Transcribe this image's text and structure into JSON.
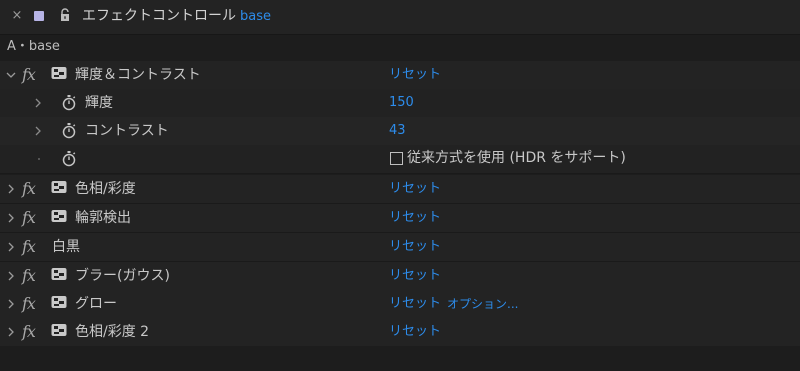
{
  "header": {
    "close_glyph": "×",
    "title": "エフェクトコントロール",
    "layer_name": "base",
    "swatch_color": "#b7b4e6"
  },
  "comp_path": "A・base",
  "accent_color": "#2d8ceb",
  "rows": [
    {
      "kind": "effect",
      "twirl": "expanded",
      "fx_label": "fx",
      "name": "輝度＆コントラスト",
      "reset": "リセット"
    },
    {
      "kind": "param",
      "name": "輝度",
      "value": "150"
    },
    {
      "kind": "param",
      "name": "コントラスト",
      "value": "43"
    },
    {
      "kind": "checkbox",
      "label": "従来方式を使用 (HDR をサポート)",
      "checked": false
    },
    {
      "kind": "effect",
      "twirl": "collapsed",
      "fx_label": "fx",
      "name": "色相/彩度",
      "reset": "リセット"
    },
    {
      "kind": "effect",
      "twirl": "collapsed",
      "fx_label": "fx",
      "name": "輪郭検出",
      "reset": "リセット"
    },
    {
      "kind": "effect",
      "twirl": "collapsed",
      "fx_label": "fx",
      "name": "白黒",
      "reset": "リセット"
    },
    {
      "kind": "effect",
      "twirl": "collapsed",
      "fx_label": "fx",
      "name": "ブラー(ガウス)",
      "reset": "リセット"
    },
    {
      "kind": "effect",
      "twirl": "collapsed",
      "fx_label": "fx",
      "name": "グロー",
      "reset": "リセット",
      "options": "オプション..."
    },
    {
      "kind": "effect",
      "twirl": "collapsed",
      "fx_label": "fx",
      "name": "色相/彩度 2",
      "reset": "リセット"
    }
  ]
}
